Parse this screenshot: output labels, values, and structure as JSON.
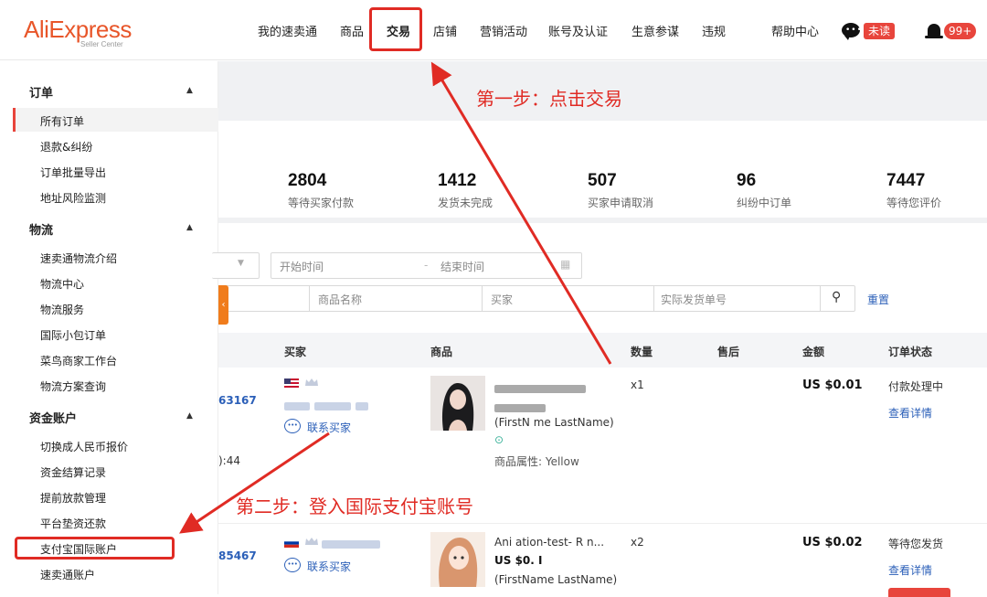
{
  "logo": {
    "text": "AliExpress",
    "sub": "Seller Center"
  },
  "nav": [
    "我的速卖通",
    "商品",
    "交易",
    "店铺",
    "营销活动",
    "账号及认证",
    "生意参谋",
    "违规",
    "帮助中心"
  ],
  "badges": {
    "unread": "未读",
    "notifications": "99+"
  },
  "sidebar": {
    "orders": {
      "title": "订单",
      "items": [
        "所有订单",
        "退款&纠纷",
        "订单批量导出",
        "地址风险监测"
      ]
    },
    "logistics": {
      "title": "物流",
      "items": [
        "速卖通物流介绍",
        "物流中心",
        "物流服务",
        "国际小包订单",
        "菜鸟商家工作台",
        "物流方案查询"
      ]
    },
    "finance": {
      "title": "资金账户",
      "items": [
        "切换成人民币报价",
        "资金结算记录",
        "提前放款管理",
        "平台垫资还款",
        "支付宝国际账户",
        "速卖通账户"
      ]
    }
  },
  "stats": [
    {
      "value": "2804",
      "label": "等待买家付款"
    },
    {
      "value": "1412",
      "label": "发货未完成"
    },
    {
      "value": "507",
      "label": "买家申请取消"
    },
    {
      "value": "96",
      "label": "纠纷中订单"
    },
    {
      "value": "7447",
      "label": "等待您评价"
    }
  ],
  "filters": {
    "start_time": "开始时间",
    "end_time": "结束时间",
    "product_name": "商品名称",
    "buyer": "买家",
    "tracking_no": "实际发货单号",
    "reset": "重置"
  },
  "table": {
    "headers": [
      "买家",
      "商品",
      "数量",
      "售后",
      "金额",
      "订单状态"
    ],
    "rows": [
      {
        "order_id_tail": "63167",
        "time_tail": "):44",
        "contact": "联系买家",
        "product_line3": "(FirstN  me LastName)",
        "attr": "商品属性: Yellow",
        "qty": "x1",
        "amount": "US $0.01",
        "status": "付款处理中",
        "detail": "查看详情"
      },
      {
        "order_id_tail": "85467",
        "contact": "联系买家",
        "product_line1": "Ani   ation-test- R   n...",
        "product_line2": "US $0.  I",
        "product_line3": "(FirstName LastName)",
        "qty": "x2",
        "amount": "US $0.02",
        "status": "等待您发货",
        "detail": "查看详情"
      }
    ]
  },
  "annotations": {
    "step1": "第一步：点击交易",
    "step2": "第二步：登入国际支付宝账号"
  },
  "colors": {
    "brand": "#e8562a",
    "annotation": "#e02b24",
    "link": "#2b5fb8"
  }
}
